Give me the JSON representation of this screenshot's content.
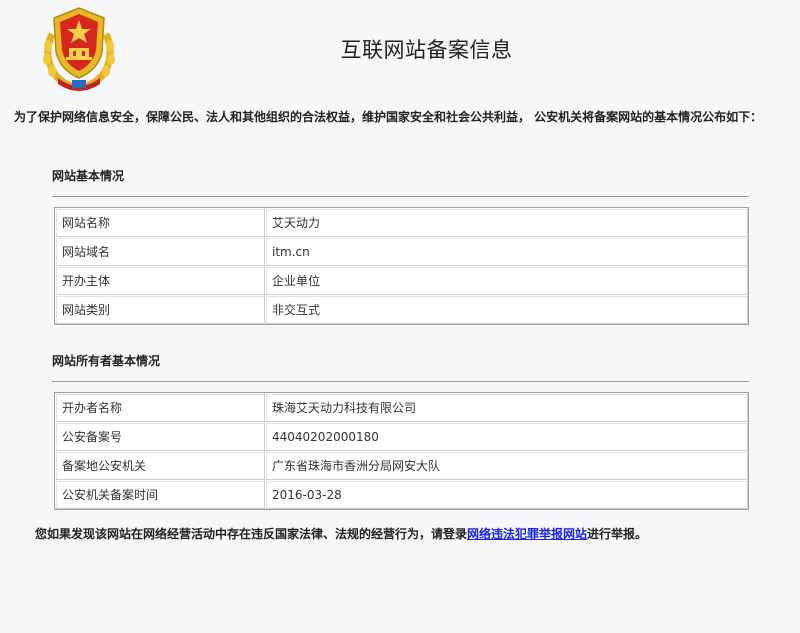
{
  "header": {
    "title": "互联网站备案信息"
  },
  "intro": "为了保护网络信息安全，保障公民、法人和其他组织的合法权益，维护国家安全和社会公共利益， 公安机关将备案网站的基本情况公布如下：",
  "site_info": {
    "heading": "网站基本情况",
    "rows": [
      {
        "label": "网站名称",
        "value": "艾天动力"
      },
      {
        "label": "网站域名",
        "value": "itm.cn"
      },
      {
        "label": "开办主体",
        "value": "企业单位"
      },
      {
        "label": "网站类别",
        "value": "非交互式"
      }
    ]
  },
  "owner_info": {
    "heading": "网站所有者基本情况",
    "rows": [
      {
        "label": "开办者名称",
        "value": "珠海艾天动力科技有限公司"
      },
      {
        "label": "公安备案号",
        "value": "44040202000180"
      },
      {
        "label": "备案地公安机关",
        "value": "广东省珠海市香洲分局网安大队"
      },
      {
        "label": "公安机关备案时间",
        "value": "2016-03-28"
      }
    ]
  },
  "report": {
    "prefix": "您如果发现该网站在网络经营活动中存在违反国家法律、法规的经营行为，请登录",
    "link": "网络违法犯罪举报网站",
    "suffix": "进行举报。"
  },
  "colors": {
    "link": "#1a22e8",
    "emblem_red": "#d7261d",
    "emblem_gold": "#e8b923"
  },
  "icons": {
    "emblem": "police-emblem-icon"
  }
}
